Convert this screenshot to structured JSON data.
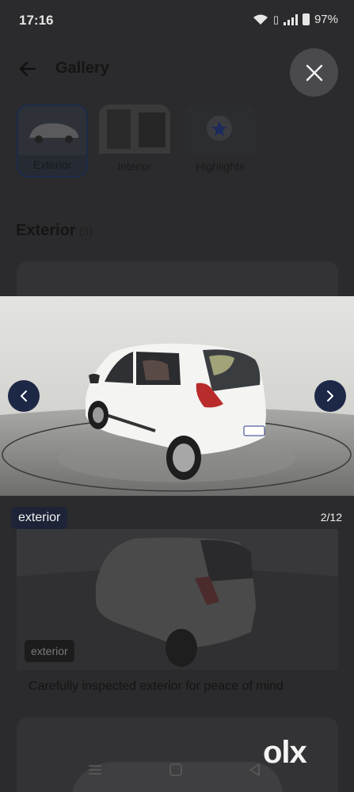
{
  "status_bar": {
    "time": "17:16",
    "battery": "97%"
  },
  "header": {
    "title": "Gallery"
  },
  "tabs": [
    {
      "label": "Exterior",
      "active": true
    },
    {
      "label": "Interior",
      "active": false
    },
    {
      "label": "Highlights",
      "active": false
    }
  ],
  "section": {
    "title": "Exterior",
    "count": "(3)"
  },
  "viewer": {
    "caption": "exterior",
    "counter": "2/12"
  },
  "background_card": {
    "tag": "exterior",
    "caption": "Carefully inspected exterior for peace of mind"
  },
  "brand": {
    "logo_text": "olx"
  },
  "colors": {
    "nav_button": "#1d2746",
    "caption_tag": "#1e2437",
    "overlay": "#2b2b2d"
  }
}
